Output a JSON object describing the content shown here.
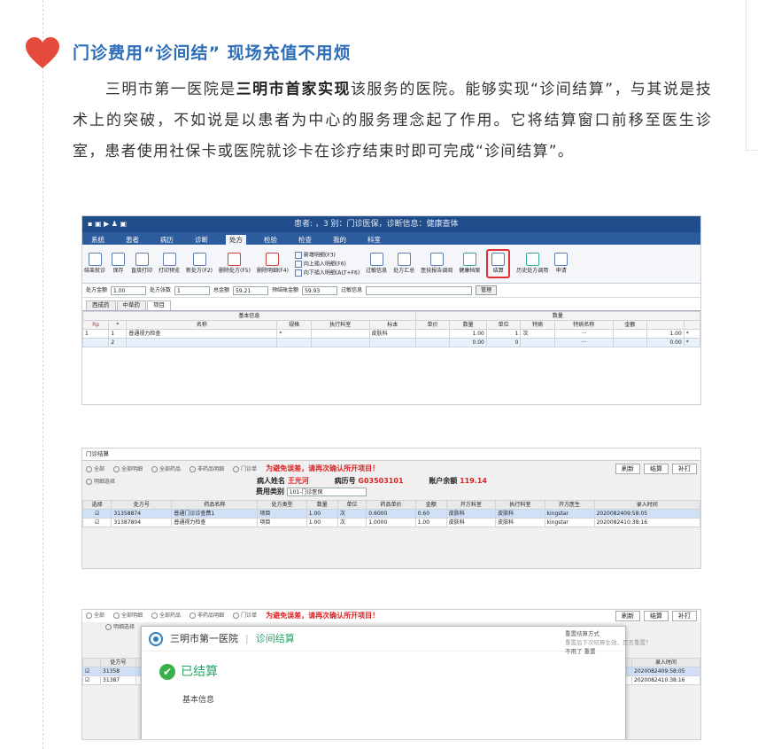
{
  "article": {
    "heading": "门诊费用“诊间结” 现场充值不用烦",
    "p_pre": "三明市第一医院是",
    "p_bold": "三明市首家实现",
    "p_post": "该服务的医院。能够实现“诊间结算”，与其说是技术上的突破，不如说是以患者为中心的服务理念起了作用。它将结算窗口前移至医生诊室，患者使用社保卡或医院就诊卡在诊疗结束时即可完成“诊间结算”。"
  },
  "shot1": {
    "patient_text": "患者:        ，3        别：门诊医保，诊断信息：健康查体",
    "menu": [
      "系统",
      "患者",
      "病历",
      "诊断",
      "处方",
      "检验",
      "检查",
      "我的",
      "科室"
    ],
    "active_menu": "处方",
    "toolbar": [
      "结束就诊",
      "保存",
      "直接打印",
      "打印预览",
      "新处方(F2)",
      "删除处方(F5)",
      "删除明细(F4)"
    ],
    "toolbar_sub": [
      "新增明细(F3)",
      "向上插入明细(F6)",
      "向下插入明细(ALT+F6)"
    ],
    "toolbar2": [
      "过敏信息",
      "处方汇总",
      "医技报告调阅",
      "健康档案",
      "结算",
      "历史处方调用",
      "申请"
    ],
    "fields": {
      "l1": "处方金额",
      "v1": "1.00",
      "l2": "处方张数",
      "v2": "1",
      "l3": "总金额",
      "v3": "59.21",
      "l4": "预结账金额",
      "v4": "59.93",
      "l5": "过敏信息",
      "btn": "管理"
    },
    "tabs": [
      "西成药",
      "中草药",
      "项目"
    ],
    "active_tab": "项目",
    "group_headers": {
      "basic": "基本信息",
      "qty": "数量"
    },
    "col_headers": [
      "Rp",
      "*",
      "名称",
      "规格",
      "执行科室",
      "标本",
      "单价",
      "数量",
      "单位",
      "特病",
      "特病名称",
      "金额"
    ],
    "rows": [
      [
        "1",
        "1",
        "普通视力检查",
        "*",
        "",
        "皮肤科",
        "",
        "1.00",
        "1",
        "次",
        "···",
        "",
        "1.00",
        "*"
      ],
      [
        "",
        "2",
        "",
        "",
        "",
        "",
        "",
        "0.00",
        "0",
        "",
        "···",
        "",
        "0.00",
        "*"
      ]
    ]
  },
  "shot2": {
    "title": "门诊结算",
    "radios": [
      "全部",
      "全部明细",
      "全部药品",
      "非药品明细",
      "门诊单",
      "明细选择"
    ],
    "warning": "为避免误差，请再次确认所开项目！",
    "btns": [
      "刷新",
      "结算",
      "补打"
    ],
    "name_label": "病人姓名",
    "name": "王光河",
    "id_label": "病历号",
    "id": "G03503101",
    "bal_label": "账户余额",
    "bal": "119.14",
    "fee_label": "费用类别",
    "fee": "101-门诊医保",
    "headers": [
      "选择",
      "处方号",
      "药品名称",
      "处方类型",
      "数量",
      "单位",
      "药品单价",
      "金额",
      "开方科室",
      "执行科室",
      "开方医生",
      "录入时间"
    ],
    "rows": [
      [
        "☑",
        "31358874",
        "普通门诊诊查费1",
        "项目",
        "1.00",
        "次",
        "0.6000",
        "0.60",
        "皮肤科",
        "皮肤科",
        "kingstar",
        "2020082409:58:05"
      ],
      [
        "☑",
        "31387804",
        "普通视力检查",
        "项目",
        "1.00",
        "次",
        "1.0000",
        "1.00",
        "皮肤科",
        "皮肤科",
        "kingstar",
        "2020082410:38:16"
      ]
    ]
  },
  "shot3": {
    "radios": [
      "全部",
      "全部明细",
      "全部药品",
      "非药品明细",
      "门诊单",
      "明细选择"
    ],
    "warning": "为避免误差，请再次确认所开项目！",
    "btns": [
      "刷新",
      "结算",
      "补打"
    ],
    "hospital": "三明市第一医院",
    "module": "诊间结算",
    "status": "已结算",
    "section": "基本信息",
    "side": [
      "重置结算方式",
      "重置后下次结算生效，是否重置？",
      "不用了  重置"
    ],
    "col_a": "处方号",
    "col_b": "录入时间",
    "row_nums": [
      "31358",
      "31387"
    ],
    "times": [
      "2020082409:58:05",
      "2020082410:38:16"
    ]
  }
}
